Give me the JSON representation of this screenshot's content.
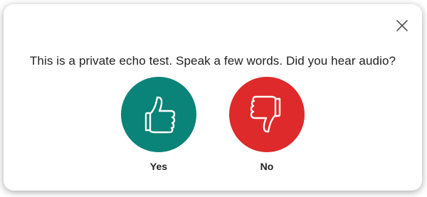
{
  "dialog": {
    "question": "This is a private echo test. Speak a few words. Did you hear audio?",
    "close_icon": "close-icon",
    "answers": [
      {
        "label": "Yes",
        "icon": "thumbs-up-icon",
        "color": "#0a8378"
      },
      {
        "label": "No",
        "icon": "thumbs-down-icon",
        "color": "#de2a2a"
      }
    ]
  }
}
